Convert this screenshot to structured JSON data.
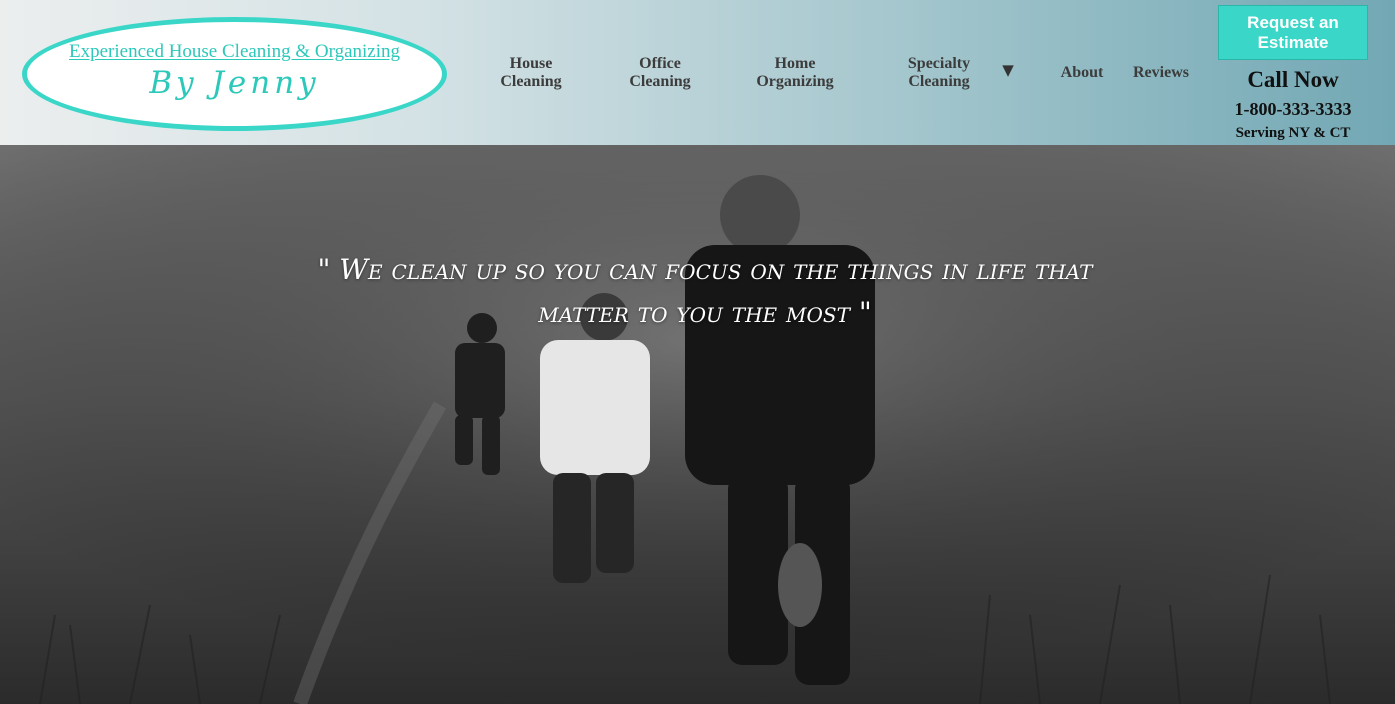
{
  "logo": {
    "title": "Experienced House Cleaning & Organizing",
    "subtitle": "By Jenny"
  },
  "nav": {
    "house_line1": "House",
    "house_line2": "Cleaning",
    "office_line1": "Office",
    "office_line2": "Cleaning",
    "home_line1": "Home",
    "home_line2": "Organizing",
    "specialty_line1": "Specialty",
    "specialty_line2": "Cleaning",
    "dropdown_arrow": "▼",
    "about": "About",
    "reviews": "Reviews"
  },
  "cta": {
    "line1": "Request an",
    "line2": "Estimate"
  },
  "contact": {
    "call_now": "Call Now",
    "phone": "1-800-333-3333",
    "serving": "Serving NY & CT"
  },
  "hero": {
    "quote_line1": "\" We clean up so you can focus on the things in life that",
    "quote_line2": "matter to you the most \""
  },
  "colors": {
    "accent": "#3ad6c8",
    "header_gradient_start": "#eceeee",
    "header_gradient_end": "#72a8b4",
    "text_dark": "#3c3c3c"
  }
}
